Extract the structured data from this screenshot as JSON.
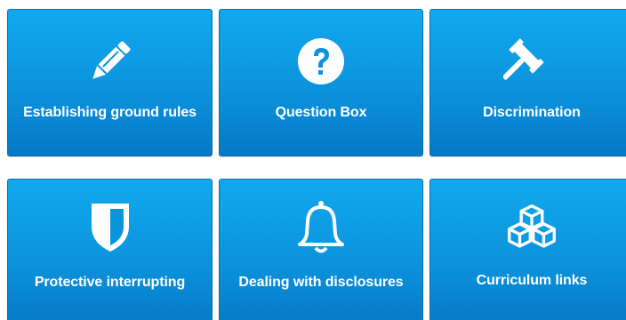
{
  "tiles": [
    {
      "label": "Establishing ground rules",
      "icon": "pencil-icon"
    },
    {
      "label": "Question Box",
      "icon": "question-circle-icon"
    },
    {
      "label": "Discrimination",
      "icon": "gavel-icon"
    },
    {
      "label": "Protective interrupting",
      "icon": "shield-icon"
    },
    {
      "label": "Dealing with disclosures",
      "icon": "bell-icon"
    },
    {
      "label": "Curriculum links",
      "icon": "cubes-icon"
    }
  ],
  "colors": {
    "tile_top": "#11a9ee",
    "tile_bottom": "#0678c5",
    "text": "#ffffff"
  }
}
